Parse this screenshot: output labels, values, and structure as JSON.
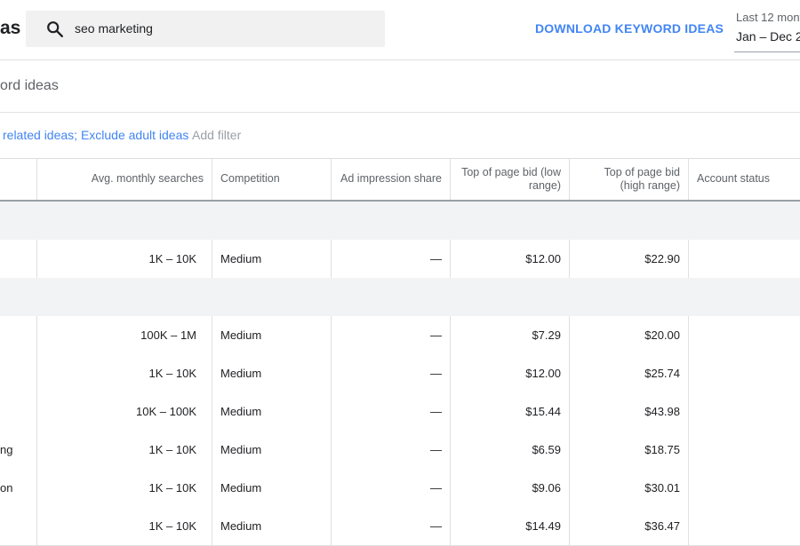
{
  "header": {
    "title_fragment": "as",
    "search": {
      "value": "seo marketing"
    },
    "download_label": "DOWNLOAD KEYWORD IDEAS",
    "date_range": {
      "label": "Last 12 mont",
      "value": "Jan – Dec 2"
    }
  },
  "subtitle": "ord ideas",
  "filters": {
    "active_text": "related ideas; Exclude adult ideas",
    "add_label": "Add filter"
  },
  "table": {
    "columns": [
      "",
      "Avg. monthly searches",
      "Competition",
      "Ad impression share",
      "Top of page bid (low range)",
      "Top of page bid (high range)",
      "Account status"
    ],
    "section1_rows": [
      {
        "keyword": "",
        "searches": "1K – 10K",
        "competition": "Medium",
        "impression": "—",
        "bid_low": "$12.00",
        "bid_high": "$22.90",
        "status": ""
      }
    ],
    "section2_rows": [
      {
        "keyword": "",
        "searches": "100K – 1M",
        "competition": "Medium",
        "impression": "—",
        "bid_low": "$7.29",
        "bid_high": "$20.00",
        "status": ""
      },
      {
        "keyword": "",
        "searches": "1K – 10K",
        "competition": "Medium",
        "impression": "—",
        "bid_low": "$12.00",
        "bid_high": "$25.74",
        "status": ""
      },
      {
        "keyword": "",
        "searches": "10K – 100K",
        "competition": "Medium",
        "impression": "—",
        "bid_low": "$15.44",
        "bid_high": "$43.98",
        "status": ""
      },
      {
        "keyword": "ng",
        "searches": "1K – 10K",
        "competition": "Medium",
        "impression": "—",
        "bid_low": "$6.59",
        "bid_high": "$18.75",
        "status": ""
      },
      {
        "keyword": "on",
        "searches": "1K – 10K",
        "competition": "Medium",
        "impression": "—",
        "bid_low": "$9.06",
        "bid_high": "$30.01",
        "status": ""
      },
      {
        "keyword": "",
        "searches": "1K – 10K",
        "competition": "Medium",
        "impression": "—",
        "bid_low": "$14.49",
        "bid_high": "$36.47",
        "status": ""
      }
    ]
  },
  "colors": {
    "accent": "#4285f4",
    "group_bg": "#f1f3f4",
    "search_bg": "#f1f1f1"
  },
  "icons": {
    "search": "search-icon"
  }
}
